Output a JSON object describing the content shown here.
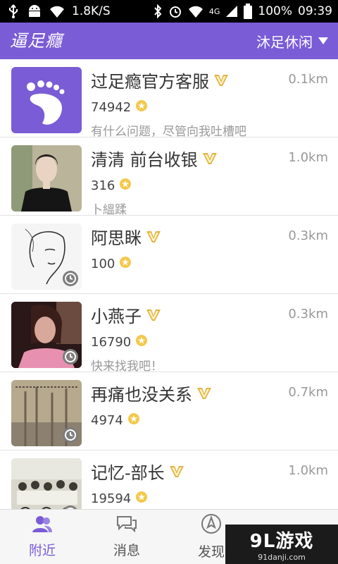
{
  "status_bar": {
    "network_speed": "1.8K/S",
    "signal_label": "4G",
    "battery": "100%",
    "time": "09:39"
  },
  "app_bar": {
    "logo_text": "逼足癮",
    "filter_label": "沐足休闲"
  },
  "users": [
    {
      "name": "过足瘾官方客服",
      "distance": "0.1km",
      "score": "74942",
      "signature": "有什么问题，尽管向我吐槽吧",
      "avatar": "foot-logo",
      "clock": false
    },
    {
      "name": "清清 前台收银",
      "distance": "1.0km",
      "score": "316",
      "signature": "卜縕蹂",
      "avatar": "photo-woman-black-top",
      "clock": false
    },
    {
      "name": "阿思眯",
      "distance": "0.3km",
      "score": "100",
      "signature": "",
      "avatar": "line-sketch-face",
      "clock": true
    },
    {
      "name": "小燕子",
      "distance": "0.3km",
      "score": "16790",
      "signature": "快来找我吧！",
      "avatar": "photo-woman-pink",
      "clock": true
    },
    {
      "name": "再痛也没关系",
      "distance": "0.7km",
      "score": "4974",
      "signature": "",
      "avatar": "misty-forest",
      "clock": true
    },
    {
      "name": "记忆-部长",
      "distance": "1.0km",
      "score": "19594",
      "signature": "",
      "avatar": "group-bicycles",
      "clock": true
    }
  ],
  "tabs": [
    {
      "label": "附近",
      "icon": "people-icon",
      "active": true
    },
    {
      "label": "消息",
      "icon": "chat-icon",
      "active": false
    },
    {
      "label": "发现",
      "icon": "compass-icon",
      "active": false
    },
    {
      "label": "",
      "icon": "profile-icon",
      "active": false
    }
  ],
  "watermark": {
    "main": "9L游戏",
    "sub": "91danji.com"
  },
  "colors": {
    "brand": "#7a5cd6",
    "vip_gold": "#e3b341",
    "coin": "#f2c94c"
  }
}
